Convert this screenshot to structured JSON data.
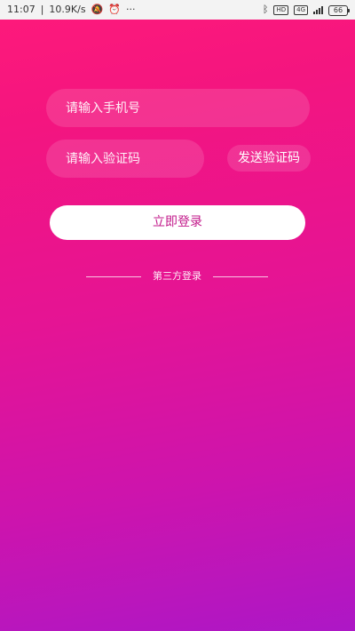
{
  "status_bar": {
    "time": "11:07",
    "net_speed": "10.9K/s",
    "separator": "|",
    "icons": [
      "mute-bell-icon",
      "alarm-clock-icon",
      "more-dots-icon",
      "bluetooth-icon",
      "hd-icon",
      "signal-icon"
    ],
    "mute_glyph": "🔕",
    "alarm_glyph": "⏰",
    "dots_glyph": "···",
    "bluetooth_glyph": "ᛒ",
    "hd_label": "HD",
    "network_label": "4G",
    "battery_level": "66"
  },
  "form": {
    "phone_placeholder": "请输入手机号",
    "code_placeholder": "请输入验证码",
    "send_code_label": "发送验证码",
    "login_label": "立即登录",
    "third_party_label": "第三方登录"
  },
  "colors": {
    "gradient_top": "#ff1a7a",
    "gradient_bottom": "#ad17c6",
    "login_text": "#c2188a"
  }
}
